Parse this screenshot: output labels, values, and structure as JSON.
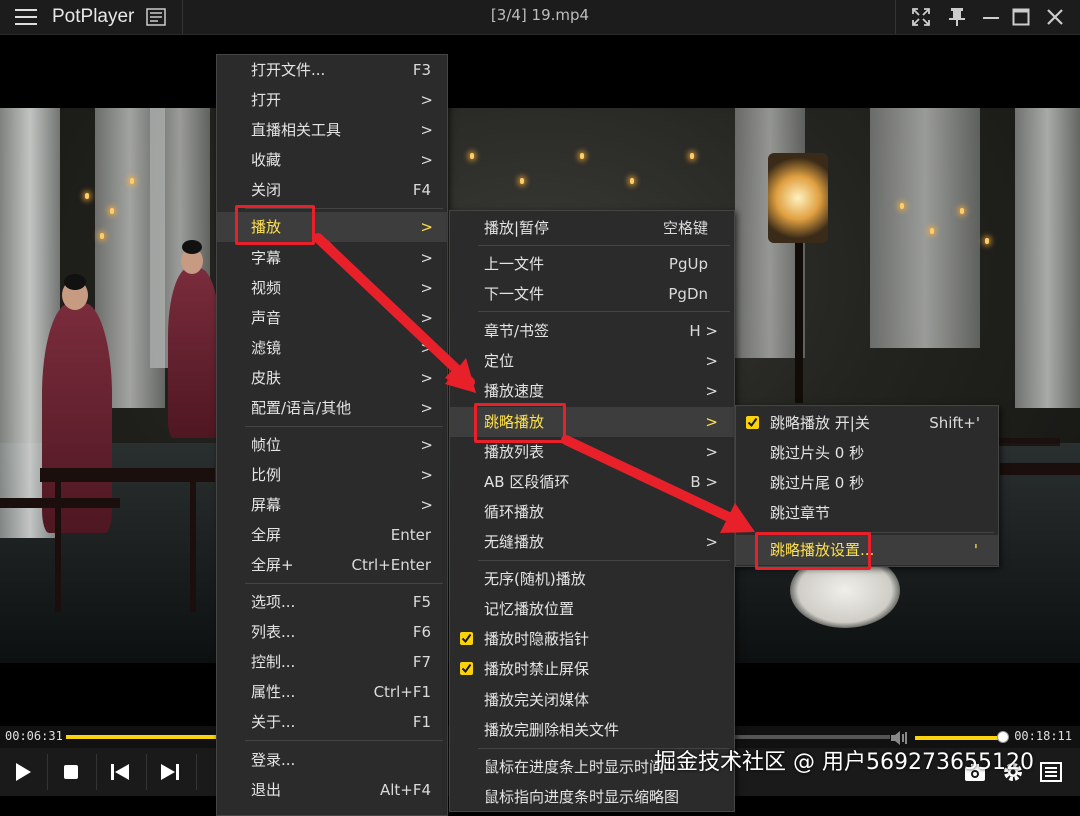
{
  "titlebar": {
    "app_name": "PotPlayer",
    "file_title": "[3/4] 19.mp4"
  },
  "playback": {
    "time_current": "00:06:31",
    "time_total": "00:18:11"
  },
  "main_menu": {
    "items": [
      {
        "label": "打开文件...",
        "shortcut": "F3"
      },
      {
        "label": "打开",
        "shortcut": ">"
      },
      {
        "label": "直播相关工具",
        "shortcut": ">"
      },
      {
        "label": "收藏",
        "shortcut": ">"
      },
      {
        "label": "关闭",
        "shortcut": "F4"
      },
      {
        "label": "播放",
        "shortcut": ">"
      },
      {
        "label": "字幕",
        "shortcut": ">"
      },
      {
        "label": "视频",
        "shortcut": ">"
      },
      {
        "label": "声音",
        "shortcut": ">"
      },
      {
        "label": "滤镜",
        "shortcut": ">"
      },
      {
        "label": "皮肤",
        "shortcut": ">"
      },
      {
        "label": "配置/语言/其他",
        "shortcut": ">"
      },
      {
        "label": "帧位",
        "shortcut": ">"
      },
      {
        "label": "比例",
        "shortcut": ">"
      },
      {
        "label": "屏幕",
        "shortcut": ">"
      },
      {
        "label": "全屏",
        "shortcut": "Enter"
      },
      {
        "label": "全屏+",
        "shortcut": "Ctrl+Enter"
      },
      {
        "label": "选项...",
        "shortcut": "F5"
      },
      {
        "label": "列表...",
        "shortcut": "F6"
      },
      {
        "label": "控制...",
        "shortcut": "F7"
      },
      {
        "label": "属性...",
        "shortcut": "Ctrl+F1"
      },
      {
        "label": "关于...",
        "shortcut": "F1"
      },
      {
        "label": "登录...",
        "shortcut": ""
      },
      {
        "label": "退出",
        "shortcut": "Alt+F4"
      }
    ]
  },
  "play_menu": {
    "items": [
      {
        "label": "播放|暂停",
        "shortcut": "空格键"
      },
      {
        "label": "上一文件",
        "shortcut": "PgUp"
      },
      {
        "label": "下一文件",
        "shortcut": "PgDn"
      },
      {
        "label": "章节/书签",
        "shortcut": "H >"
      },
      {
        "label": "定位",
        "shortcut": ">"
      },
      {
        "label": "播放速度",
        "shortcut": ">"
      },
      {
        "label": "跳略播放",
        "shortcut": ">"
      },
      {
        "label": "播放列表",
        "shortcut": ">"
      },
      {
        "label": "AB 区段循环",
        "shortcut": "B >"
      },
      {
        "label": "循环播放",
        "shortcut": ""
      },
      {
        "label": "无缝播放",
        "shortcut": ">"
      },
      {
        "label": "无序(随机)播放",
        "shortcut": ""
      },
      {
        "label": "记忆播放位置",
        "shortcut": ""
      },
      {
        "label": "播放时隐蔽指针",
        "shortcut": "",
        "checked": true
      },
      {
        "label": "播放时禁止屏保",
        "shortcut": "",
        "checked": true
      },
      {
        "label": "播放完关闭媒体",
        "shortcut": ""
      },
      {
        "label": "播放完删除相关文件",
        "shortcut": ""
      },
      {
        "label": "鼠标在进度条上时显示时间",
        "shortcut": ""
      },
      {
        "label": "鼠标指向进度条时显示缩略图",
        "shortcut": ""
      }
    ]
  },
  "skip_menu": {
    "items": [
      {
        "label": "跳略播放 开|关",
        "shortcut": "Shift+'",
        "checked": true
      },
      {
        "label": "跳过片头 0 秒",
        "shortcut": ""
      },
      {
        "label": "跳过片尾 0 秒",
        "shortcut": ""
      },
      {
        "label": "跳过章节",
        "shortcut": ""
      },
      {
        "label": "跳略播放设置...",
        "shortcut": "'"
      }
    ]
  },
  "watermark": "掘金技术社区 @ 用户569273655120",
  "colors": {
    "accent": "#fbd30c",
    "highlight_text": "#ffe14a",
    "annotation_red": "#e8202a"
  }
}
